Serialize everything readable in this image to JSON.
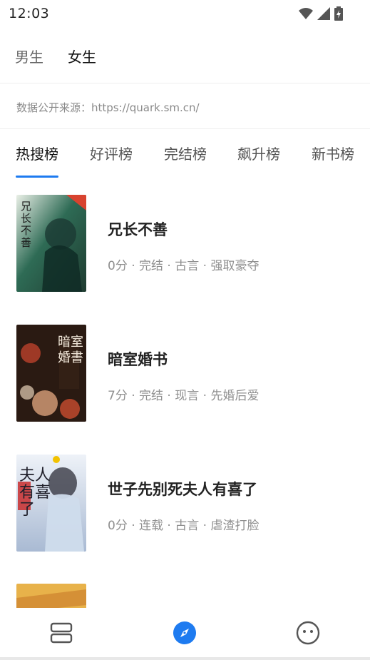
{
  "status_bar": {
    "time": "12:03"
  },
  "gender_tabs": [
    {
      "label": "男生",
      "active": false
    },
    {
      "label": "女生",
      "active": true
    }
  ],
  "source_note": "数据公开来源：https://quark.sm.cn/",
  "rank_tabs": [
    {
      "label": "热搜榜",
      "active": true
    },
    {
      "label": "好评榜",
      "active": false
    },
    {
      "label": "完结榜",
      "active": false
    },
    {
      "label": "飙升榜",
      "active": false
    },
    {
      "label": "新书榜",
      "active": false
    }
  ],
  "books": [
    {
      "title": "兄长不善",
      "meta": "0分 · 完结 · 古言 · 强取豪夺",
      "cover_text": "兄长不善",
      "cover_colors": [
        "#1f4a3c",
        "#2e6b55"
      ]
    },
    {
      "title": "暗室婚书",
      "meta": "7分 · 完结 · 现言 · 先婚后爱",
      "cover_text": "暗室婚書",
      "cover_colors": [
        "#2a1a12",
        "#6b2a18"
      ]
    },
    {
      "title": "世子先别死夫人有喜了",
      "meta": "0分 · 连载 · 古言 · 虐渣打脸",
      "cover_text": "夫人有喜了",
      "cover_colors": [
        "#dfe6f1",
        "#9fb0cc"
      ]
    },
    {
      "title": "",
      "meta": "",
      "cover_text": "",
      "cover_colors": [
        "#e8b24a",
        "#c87a2a"
      ]
    }
  ],
  "bottom_nav": [
    {
      "icon": "bookshelf-icon",
      "active": false
    },
    {
      "icon": "compass-icon",
      "active": true
    },
    {
      "icon": "profile-face-icon",
      "active": false
    }
  ],
  "colors": {
    "accent": "#1e7bf0",
    "text_primary": "#222222",
    "text_secondary": "#8f8f8f"
  }
}
